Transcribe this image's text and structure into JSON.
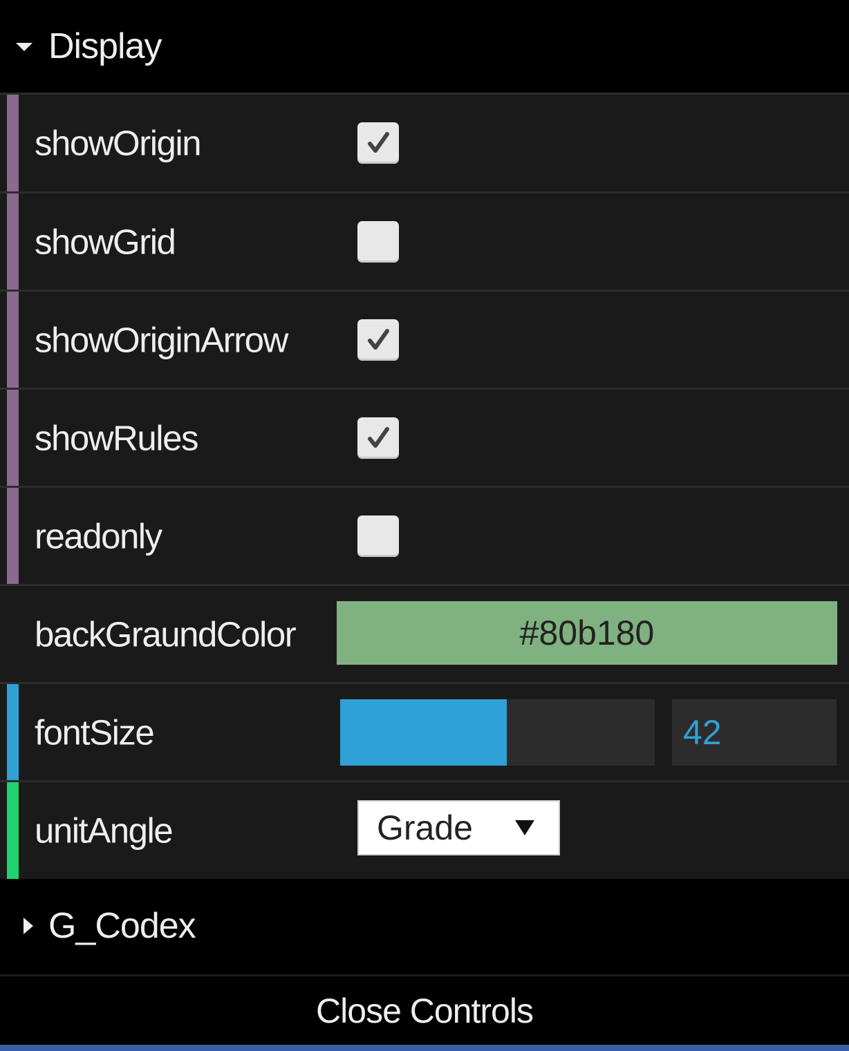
{
  "folders": {
    "display": {
      "title": "Display",
      "expanded": true,
      "arrow_icon": "triangle-down-icon"
    },
    "codex": {
      "title": "G_Codex",
      "expanded": false,
      "arrow_icon": "triangle-right-icon"
    }
  },
  "controls": {
    "showOrigin": {
      "label": "showOrigin",
      "checked": true
    },
    "showGrid": {
      "label": "showGrid",
      "checked": false
    },
    "showOriginArrow": {
      "label": "showOriginArrow",
      "checked": true
    },
    "showRules": {
      "label": "showRules",
      "checked": true
    },
    "readonly": {
      "label": "readonly",
      "checked": false
    },
    "backGraundColor": {
      "label": "backGraundColor",
      "value": "#80b180"
    },
    "fontSize": {
      "label": "fontSize",
      "value": "42",
      "fill_fraction": 0.53
    },
    "unitAngle": {
      "label": "unitAngle",
      "selected": "Grade",
      "arrow_icon": "triangle-down-icon"
    }
  },
  "close_controls": {
    "label": "Close Controls"
  },
  "colors": {
    "boolean_stripe": "#8a6a8e",
    "color_stripe": "#3b5ea8",
    "number_stripe": "#2fa1d6",
    "option_stripe": "#1ed36f",
    "slider_fill": "#2fa1d6",
    "color_swatch": "#80b180"
  }
}
